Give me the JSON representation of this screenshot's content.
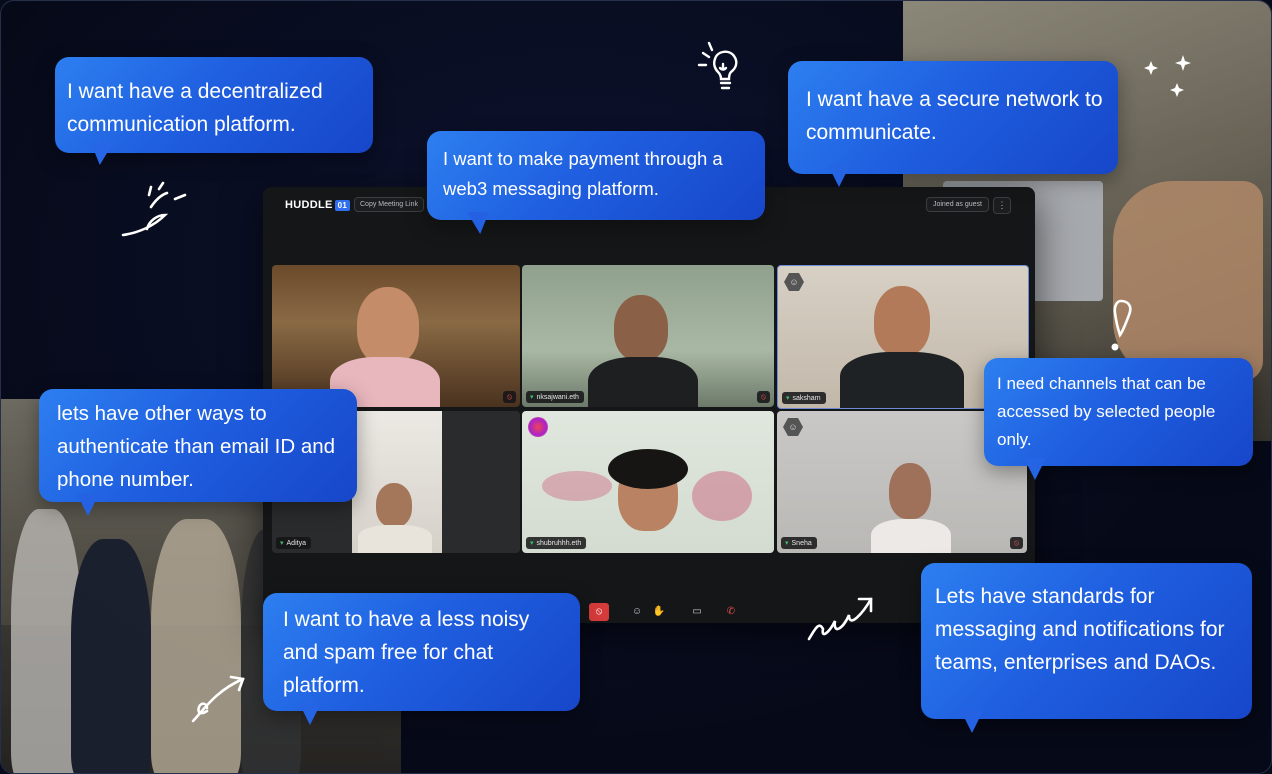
{
  "meeting": {
    "logo_text": "HUDDLE",
    "logo_badge": "01",
    "copy_link_label": "Copy Meeting Link",
    "joined_label": "Joined as guest",
    "more_label": "⋮",
    "participants": [
      {
        "name": ""
      },
      {
        "name": "nksajwani.eth"
      },
      {
        "name": "saksham"
      },
      {
        "name": "Aditya"
      },
      {
        "name": "shubruhhh.eth"
      },
      {
        "name": "Sneha"
      }
    ]
  },
  "bubbles": {
    "decentralized": "I want have a decentralized communication platform.",
    "payment": "I want to make payment through a web3 messaging platform.",
    "secure": "I want have a secure network to communicate.",
    "auth": "lets have other ways to authenticate than email ID and phone number.",
    "channels": "I need channels that can be accessed by selected people only.",
    "noisy": "I want to have a less noisy and spam free for chat platform.",
    "standards": "Lets have standards for messaging and notifications for teams, enterprises and DAOs."
  },
  "icons": {
    "signal": "signal-icon",
    "mute": "mic-off-icon",
    "mic": "mic-off-icon",
    "emoji": "emoji-icon",
    "hand": "raise-hand-icon",
    "share": "screen-share-icon",
    "leave": "leave-call-icon"
  }
}
